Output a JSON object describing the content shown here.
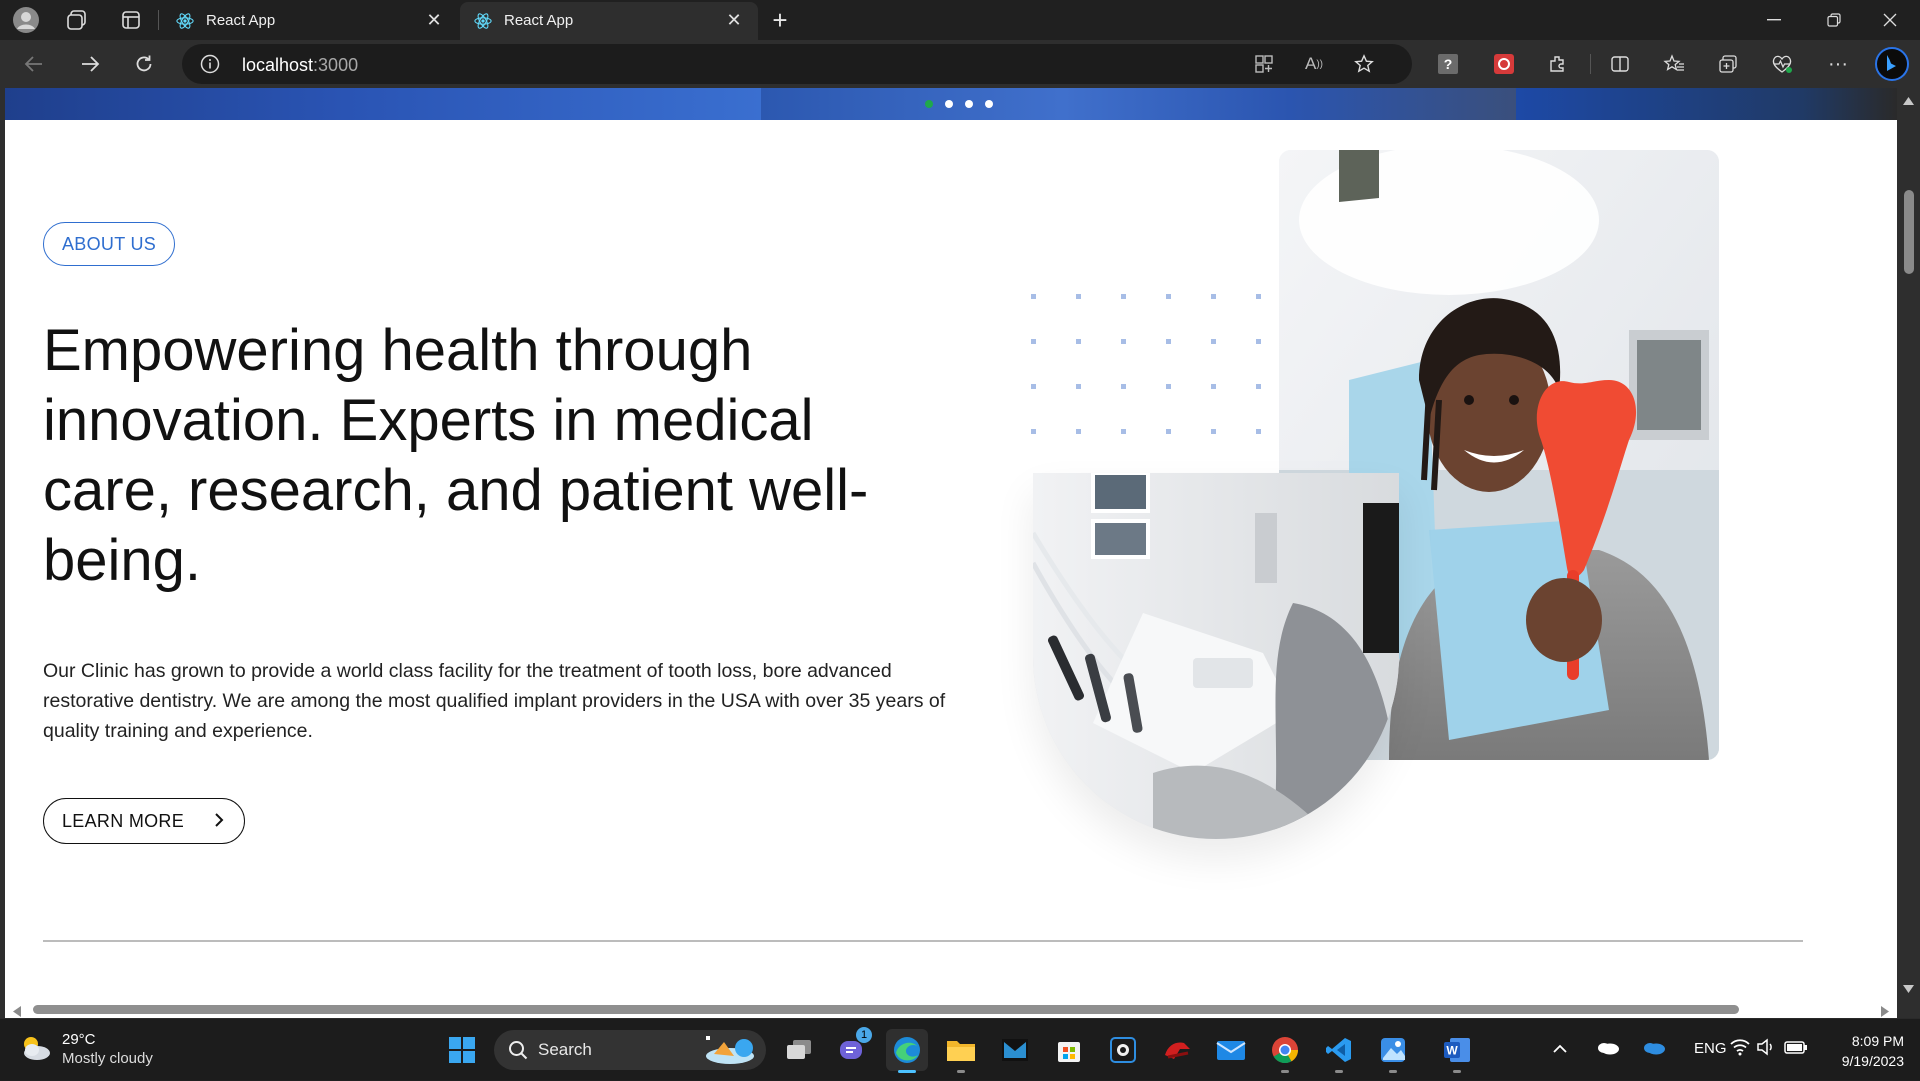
{
  "browser": {
    "tabs": [
      {
        "title": "React App",
        "active": false
      },
      {
        "title": "React App",
        "active": true
      }
    ],
    "address": {
      "host": "localhost",
      "port": ":3000"
    }
  },
  "page": {
    "about_pill": "ABOUT US",
    "headline": "Empowering health through innovation. Experts in medical care, research, and patient well-being.",
    "body": "Our Clinic has grown to provide a world class facility for the treatment of tooth loss, bore advanced restorative dentistry. We are among the most qualified implant providers in the USA with over 35 years of quality training and experience.",
    "cta": "LEARN MORE",
    "carousel_dots": 4,
    "carousel_active": 0,
    "accent_color": "#2f6ecf"
  },
  "taskbar": {
    "weather": {
      "temp": "29°C",
      "condition": "Mostly cloudy"
    },
    "search_label": "Search",
    "teams_badge": "1",
    "language": "ENG",
    "time": "8:09 PM",
    "date": "9/19/2023"
  }
}
